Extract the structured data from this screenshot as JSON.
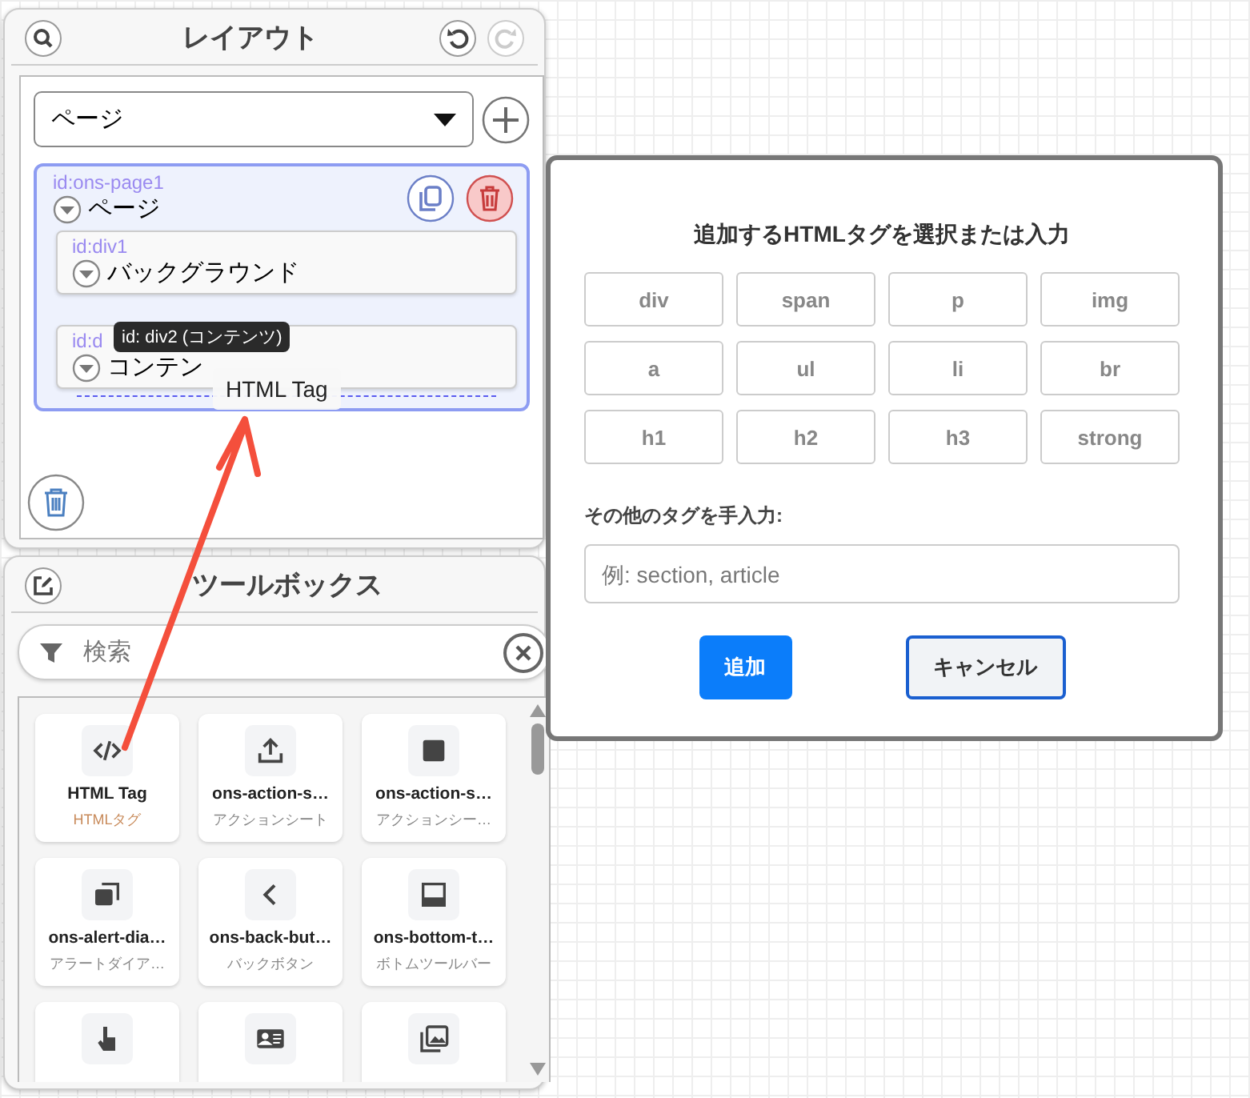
{
  "layout_panel": {
    "title": "レイアウト",
    "page_select": {
      "value": "ページ"
    },
    "tree": [
      {
        "id_label": "id:ons-page1",
        "label": "ページ",
        "selected": true,
        "expanded": true,
        "children": [
          {
            "id_label": "id:div1",
            "label": "バックグラウンド",
            "selected": false,
            "expanded": true
          },
          {
            "id_label": "id:d",
            "label": "コンテン",
            "selected": false,
            "expanded": true
          }
        ]
      }
    ],
    "tooltip": "id: div2 (コンテンツ)",
    "drag_label": "HTML Tag"
  },
  "toolbox": {
    "title": "ツールボックス",
    "search": {
      "placeholder": "検索"
    },
    "items": [
      {
        "kind": "code",
        "name": "HTML Tag",
        "subtitle": "HTMLタグ"
      },
      {
        "kind": "upload",
        "name": "ons-action-s…",
        "subtitle": "アクションシート"
      },
      {
        "kind": "square",
        "name": "ons-action-s…",
        "subtitle": "アクションシー…"
      },
      {
        "kind": "dialog",
        "name": "ons-alert-dia…",
        "subtitle": "アラートダイア…"
      },
      {
        "kind": "back",
        "name": "ons-back-but…",
        "subtitle": "バックボタン"
      },
      {
        "kind": "bottombar",
        "name": "ons-bottom-t…",
        "subtitle": "ボトムツールバー"
      },
      {
        "kind": "tap"
      },
      {
        "kind": "card"
      },
      {
        "kind": "gallery"
      }
    ]
  },
  "dialog": {
    "title": "追加するHTMLタグを選択または入力",
    "tags": [
      "div",
      "span",
      "p",
      "img",
      "a",
      "ul",
      "li",
      "br",
      "h1",
      "h2",
      "h3",
      "strong"
    ],
    "custom_label": "その他のタグを手入力:",
    "custom_input": {
      "placeholder": "例: section, article"
    },
    "buttons": [
      {
        "label": "追加",
        "kind": "primary"
      },
      {
        "label": "キャンセル",
        "kind": "secondary"
      }
    ]
  }
}
